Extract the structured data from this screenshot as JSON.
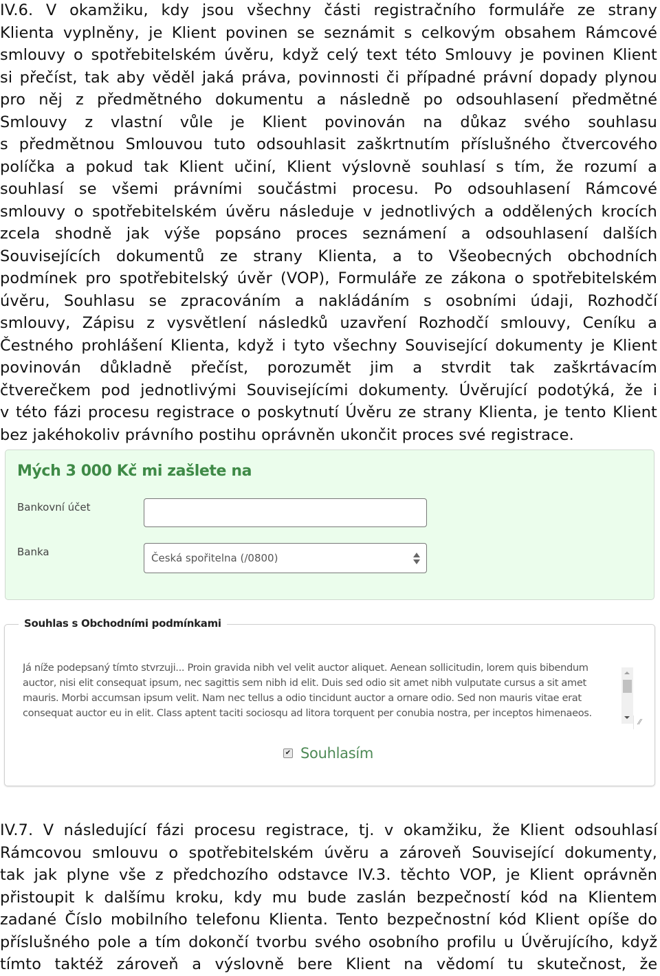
{
  "section_iv6": {
    "lines": [
      "IV.6. V okamžiku, kdy jsou všechny části registračního formuláře ze strany",
      "Klienta vyplněny, je Klient povinen se seznámit s celkovým obsahem Rámcové",
      "smlouvy o spotřebitelském úvěru, když celý text této Smlouvy je povinen Klient",
      "si přečíst, tak aby věděl jaká práva, povinnosti či případné právní dopady plynou",
      "pro něj z předmětného dokumentu a následně po odsouhlasení předmětné",
      "Smlouvy z vlastní vůle je Klient povinován na důkaz svého souhlasu",
      "s předmětnou Smlouvou tuto odsouhlasit zaškrtnutím příslušného čtvercového",
      "políčka a pokud tak Klient učiní, Klient výslovně souhlasí s tím, že rozumí a",
      "souhlasí se všemi právními součástmi procesu. Po odsouhlasení Rámcové",
      "smlouvy o spotřebitelském úvěru následuje v jednotlivých a oddělených krocích",
      "zcela shodně jak výše popsáno proces seznámení a odsouhlasení dalších",
      "Souvisejících dokumentů ze strany Klienta, a to Všeobecných obchodních",
      "podmínek pro spotřebitelský úvěr (VOP), Formuláře ze zákona o spotřebitelském",
      "úvěru, Souhlasu se zpracováním a nakládáním s osobními údaji, Rozhodčí",
      "smlouvy, Zápisu z vysvětlení následků uzavření Rozhodčí smlouvy, Ceníku a",
      "Čestného prohlášení Klienta, když i tyto všechny Související dokumenty je Klient",
      "povinován důkladně přečíst, porozumět jim a stvrdit tak zaškrtávacím",
      "čtverečkem pod jednotlivými Souvisejícími dokumenty. Úvěrující podotýká, že i",
      "v této fázi procesu registrace o poskytnutí Úvěru ze strany Klienta, je tento Klient",
      "bez jakéhokoliv právního postihu oprávněn ukončit proces své registrace."
    ]
  },
  "payout_form": {
    "title": "Mých 3 000 Kč mi zašlete na",
    "account_label": "Bankovní účet",
    "account_value": "",
    "bank_label": "Banka",
    "bank_selected": "Česká spořitelna (/0800)",
    "accent_color": "#3f8a47",
    "background_color": "#ebfdec"
  },
  "consent": {
    "legend": "Souhlas s Obchodními podmínkami",
    "terms_lines": [
      "Já níže podepsaný   tímto stvrzuji... Proin gravida nibh vel velit auctor aliquet. Aenean sollicitudin, lorem quis bibendum",
      "auctor, nisi elit consequat ipsum, nec sagittis sem nibh id elit. Duis sed odio sit amet nibh vulputate cursus a sit amet",
      "mauris. Morbi accumsan ipsum velit. Nam nec tellus a odio tincidunt auctor a ornare odio. Sed non mauris vitae erat",
      "consequat auctor eu in elit. Class aptent taciti sociosqu ad litora torquent per conubia nostra, per inceptos himenaeos."
    ],
    "agree_label": "Souhlasím",
    "agree_checked": true,
    "check_glyph": "✔",
    "resize_glyph": "⁄⁄"
  },
  "section_iv7": {
    "lines": [
      "IV.7. V následující fázi procesu registrace, tj. v okamžiku, že Klient odsouhlasí",
      "Rámcovou smlouvu o spotřebitelském úvěru a zároveň Související dokumenty,",
      "tak jak plyne vše z předchozího odstavce IV.3. těchto VOP, je Klient oprávněn",
      "přistoupit k dalšímu kroku, kdy mu bude zaslán bezpečností kód na Klientem",
      "zadané Číslo mobilního telefonu Klienta. Tento bezpečnostní kód Klient opíše do",
      "příslušného pole a tím dokončí tvorbu svého osobního profilu u Úvěrujícího, když",
      "tímto taktéž zároveň a výslovně bere Klient na vědomí tu skutečnost, že"
    ]
  }
}
